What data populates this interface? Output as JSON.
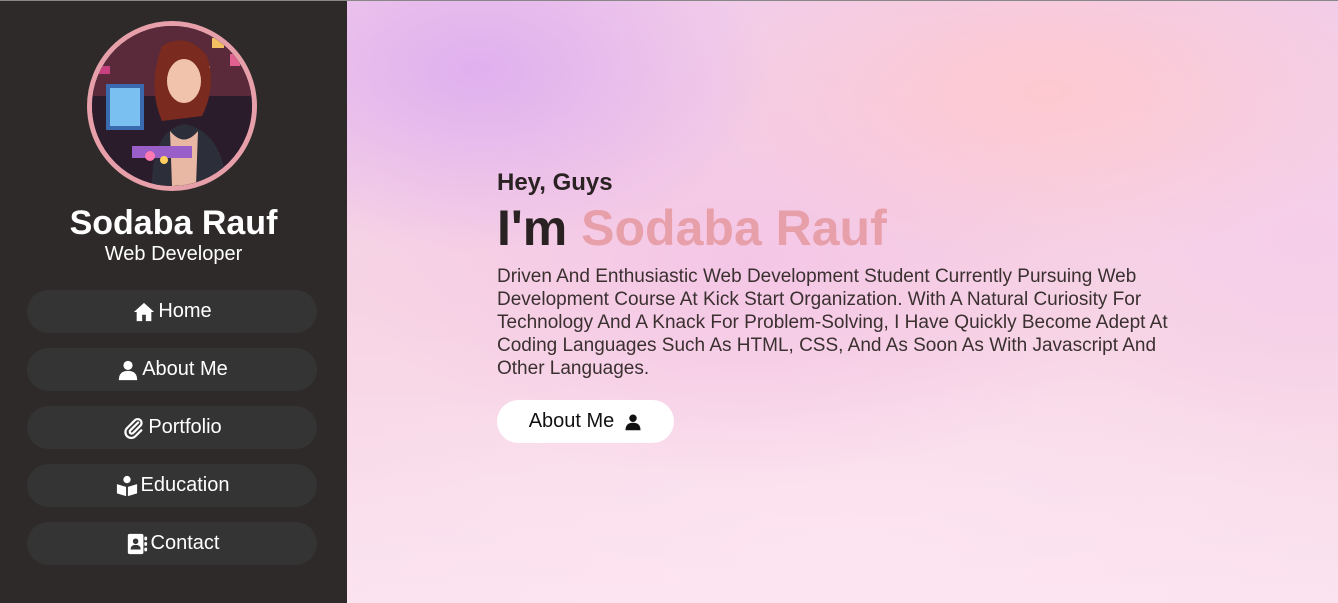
{
  "profile": {
    "name": "Sodaba Rauf",
    "role": "Web Developer",
    "avatar_alt": "avatar"
  },
  "nav": {
    "items": [
      {
        "label": "Home",
        "icon": "home-icon"
      },
      {
        "label": "About Me",
        "icon": "user-icon"
      },
      {
        "label": "Portfolio",
        "icon": "paperclip-icon"
      },
      {
        "label": "Education",
        "icon": "book-reader-icon"
      },
      {
        "label": "Contact",
        "icon": "address-book-icon"
      }
    ]
  },
  "hero": {
    "greeting": "Hey, Guys",
    "headline_prefix": "I'm",
    "headline_name": "Sodaba Rauf",
    "description": "Driven And Enthusiastic Web Development Student Currently Pursuing Web Development Course At Kick Start Organization. With A Natural Curiosity For Technology And A Knack For Problem-Solving, I Have Quickly Become Adept At Coding Languages Such As HTML, CSS, And As Soon As With Javascript And Other Languages.",
    "cta_label": "About Me",
    "cta_icon": "user-icon"
  },
  "colors": {
    "sidebar_bg": "#2e2a29",
    "nav_item_bg": "#343434",
    "accent": "#e79fa9",
    "heading_text": "#2a2222"
  }
}
